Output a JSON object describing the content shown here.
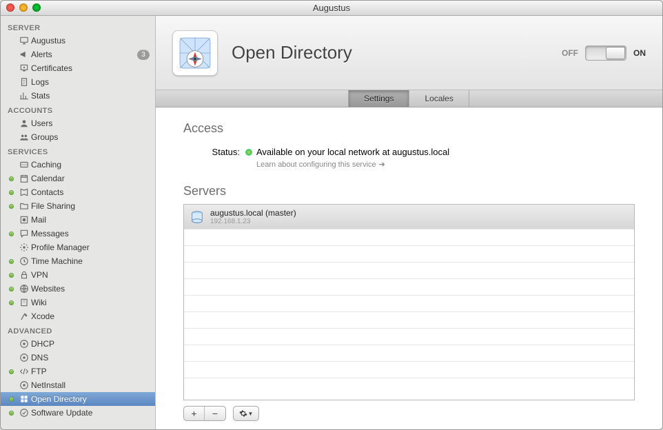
{
  "window": {
    "title": "Augustus"
  },
  "sidebar": {
    "sections": [
      {
        "label": "SERVER",
        "items": [
          {
            "label": "Augustus",
            "icon": "monitor",
            "on": false
          },
          {
            "label": "Alerts",
            "icon": "bullhorn",
            "on": false,
            "badge": "3"
          },
          {
            "label": "Certificates",
            "icon": "cert",
            "on": false
          },
          {
            "label": "Logs",
            "icon": "doc",
            "on": false
          },
          {
            "label": "Stats",
            "icon": "bars",
            "on": false
          }
        ]
      },
      {
        "label": "ACCOUNTS",
        "items": [
          {
            "label": "Users",
            "icon": "user",
            "on": false
          },
          {
            "label": "Groups",
            "icon": "group",
            "on": false
          }
        ]
      },
      {
        "label": "SERVICES",
        "items": [
          {
            "label": "Caching",
            "icon": "cache",
            "on": false
          },
          {
            "label": "Calendar",
            "icon": "cal",
            "on": true
          },
          {
            "label": "Contacts",
            "icon": "book",
            "on": true
          },
          {
            "label": "File Sharing",
            "icon": "folder",
            "on": true
          },
          {
            "label": "Mail",
            "icon": "stamp",
            "on": false
          },
          {
            "label": "Messages",
            "icon": "bubble",
            "on": true
          },
          {
            "label": "Profile Manager",
            "icon": "gear",
            "on": false
          },
          {
            "label": "Time Machine",
            "icon": "clock",
            "on": true
          },
          {
            "label": "VPN",
            "icon": "lock",
            "on": true
          },
          {
            "label": "Websites",
            "icon": "globe",
            "on": true
          },
          {
            "label": "Wiki",
            "icon": "wiki",
            "on": true
          },
          {
            "label": "Xcode",
            "icon": "hammer",
            "on": false
          }
        ]
      },
      {
        "label": "ADVANCED",
        "items": [
          {
            "label": "DHCP",
            "icon": "net",
            "on": false
          },
          {
            "label": "DNS",
            "icon": "net",
            "on": false
          },
          {
            "label": "FTP",
            "icon": "ftp",
            "on": true
          },
          {
            "label": "NetInstall",
            "icon": "net",
            "on": false
          },
          {
            "label": "Open Directory",
            "icon": "dir",
            "on": true,
            "selected": true
          },
          {
            "label": "Software Update",
            "icon": "update",
            "on": true
          }
        ]
      }
    ]
  },
  "header": {
    "title": "Open Directory",
    "switch": {
      "off": "OFF",
      "on": "ON",
      "state": "on"
    }
  },
  "tabs": [
    {
      "label": "Settings",
      "active": true
    },
    {
      "label": "Locales",
      "active": false
    }
  ],
  "access": {
    "title": "Access",
    "status_label": "Status:",
    "status_text": "Available on your local network at augustus.local",
    "learn": "Learn about configuring this service"
  },
  "servers": {
    "title": "Servers",
    "rows": [
      {
        "name": "augustus.local (master)",
        "ip": "192.168.1.23",
        "selected": true
      }
    ]
  }
}
